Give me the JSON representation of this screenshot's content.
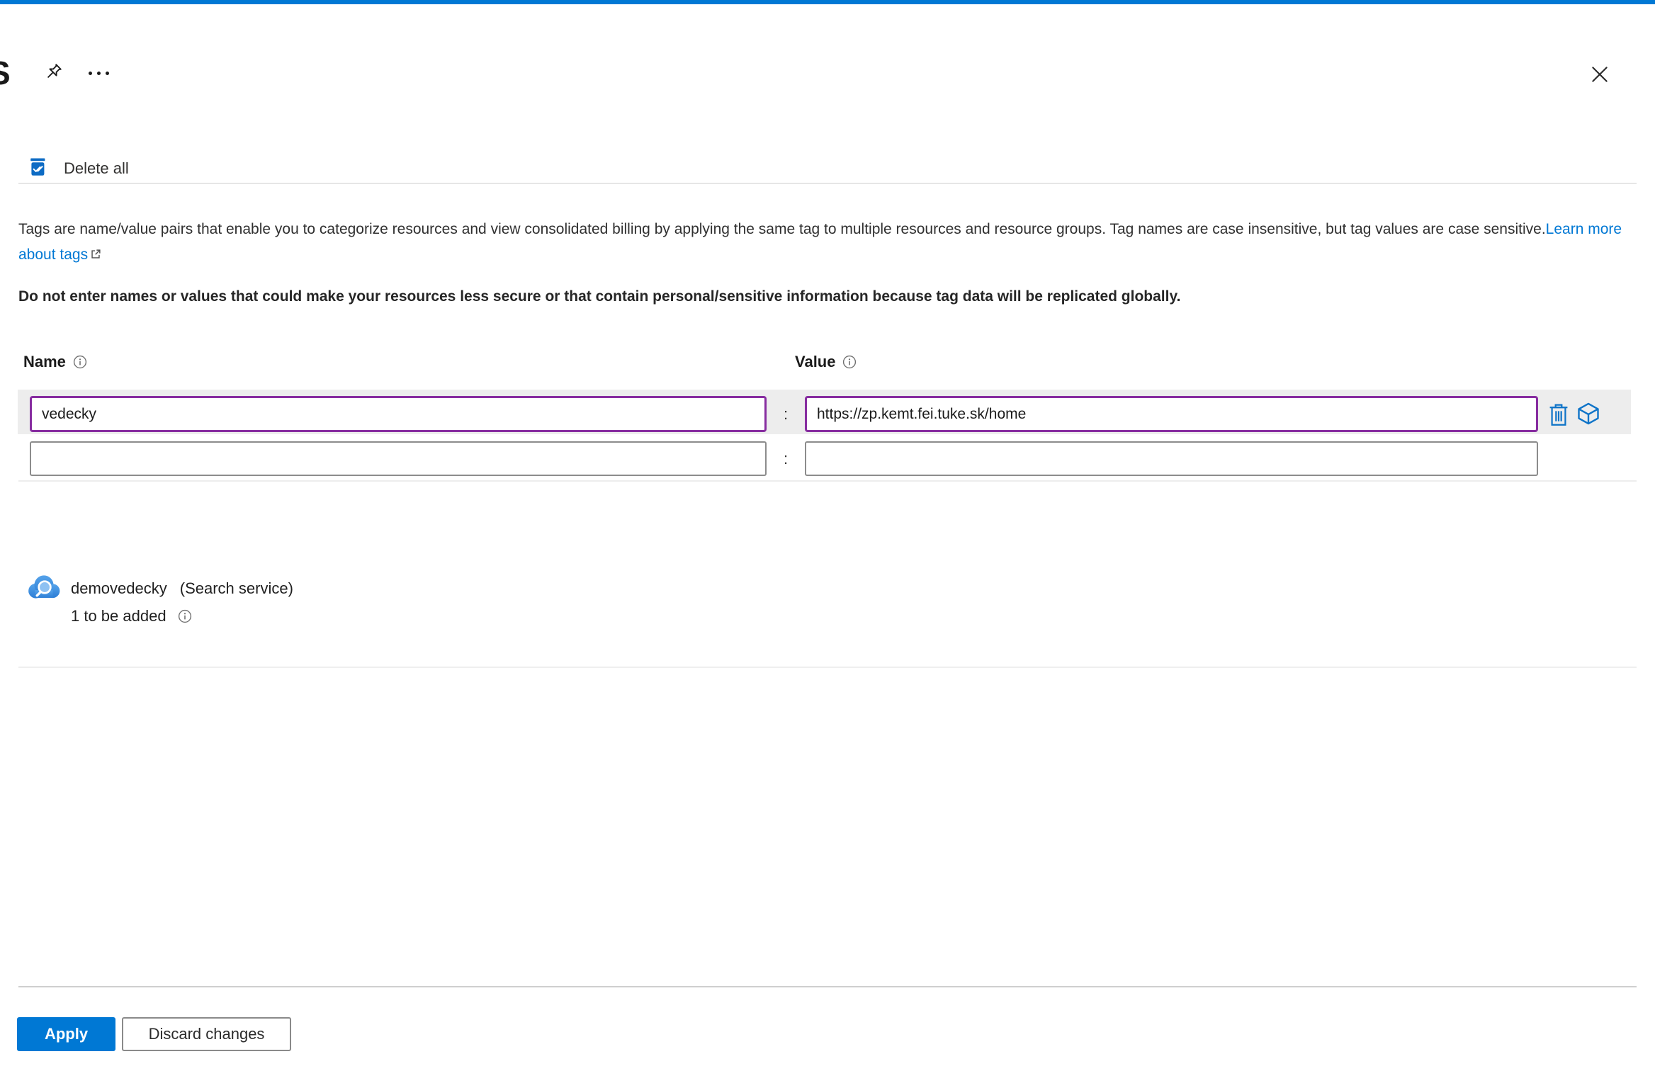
{
  "header": {
    "partial_title": "S"
  },
  "toolbar": {
    "delete_all_label": "Delete all"
  },
  "description": {
    "text": "Tags are name/value pairs that enable you to categorize resources and view consolidated billing by applying the same tag to multiple resources and resource groups. Tag names are case insensitive, but tag values are case sensitive.",
    "link_label": "Learn more about tags",
    "warning": "Do not enter names or values that could make your resources less secure or that contain personal/sensitive information because tag data will be replicated globally."
  },
  "tags_table": {
    "name_header": "Name",
    "value_header": "Value",
    "separator": ":",
    "rows": [
      {
        "name": "vedecky",
        "value": "https://zp.kemt.fei.tuke.sk/home"
      },
      {
        "name": "",
        "value": ""
      }
    ]
  },
  "resource": {
    "name": "demovedecky",
    "type": "(Search service)",
    "status": "1 to be added"
  },
  "footer": {
    "apply_label": "Apply",
    "discard_label": "Discard changes"
  },
  "colors": {
    "accent": "#0078d4",
    "modified_border": "#872da0"
  }
}
